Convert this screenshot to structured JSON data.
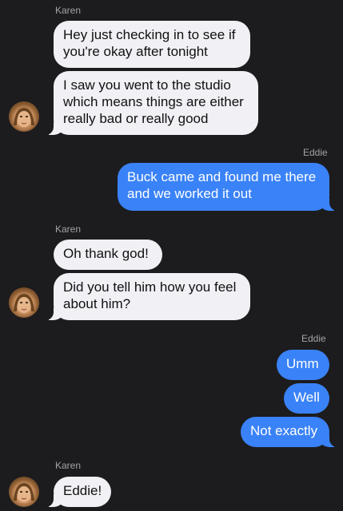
{
  "groups": [
    {
      "sender": "Karen",
      "messages": [
        {
          "lines": [
            "Hey just checking in to see if",
            "you're okay after tonight"
          ]
        },
        {
          "lines": [
            "I saw you went to the studio",
            "which means things are either",
            "really bad or really good"
          ]
        }
      ]
    },
    {
      "sender": "Eddie",
      "messages": [
        {
          "lines": [
            "Buck came and found me there",
            "and we worked it out"
          ]
        }
      ]
    },
    {
      "sender": "Karen",
      "messages": [
        {
          "lines": [
            "Oh thank god!"
          ]
        },
        {
          "lines": [
            "Did you tell him how you feel",
            "about him?"
          ]
        }
      ]
    },
    {
      "sender": "Eddie",
      "messages": [
        {
          "lines": [
            "Umm"
          ]
        },
        {
          "lines": [
            "Well"
          ]
        },
        {
          "lines": [
            "Not exactly"
          ]
        }
      ]
    },
    {
      "sender": "Karen",
      "messages": [
        {
          "lines": [
            "Eddie!"
          ]
        }
      ]
    }
  ],
  "colors": {
    "background": "#1c1c1e",
    "incoming_bubble": "#f0f0f5",
    "outgoing_bubble": "#3a82f7",
    "sender_label": "#a3a3a8"
  },
  "icons": {
    "contact_avatar": "avatar-photo"
  }
}
